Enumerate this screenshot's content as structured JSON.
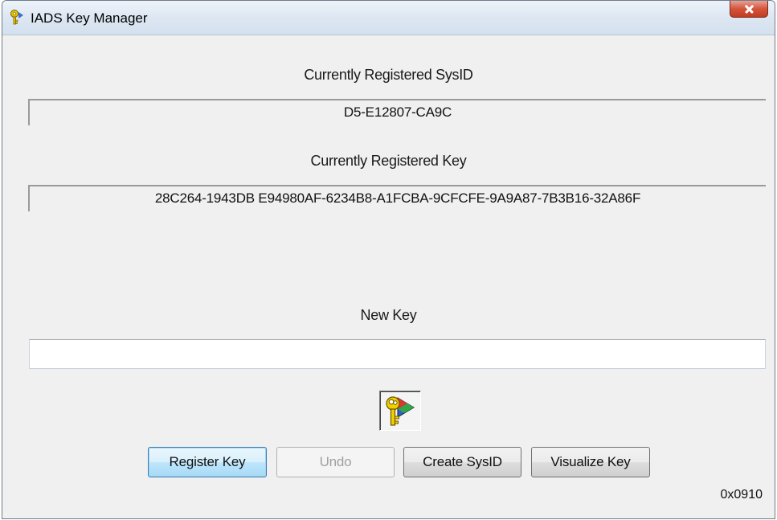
{
  "window": {
    "title": "IADS Key Manager",
    "app_icon": "key-icon",
    "close_icon": "close-icon"
  },
  "sysid": {
    "label": "Currently Registered SysID",
    "value": "D5-E12807-CA9C"
  },
  "registered_key": {
    "label": "Currently Registered Key",
    "value": "28C264-1943DB  E94980AF-6234B8-A1FCBA-9CFCFE-9A9A87-7B3B16-32A86F"
  },
  "new_key": {
    "label": "New Key",
    "value": ""
  },
  "key_visual_icon": "key-visual-icon",
  "buttons": {
    "register_key": "Register Key",
    "undo": "Undo",
    "create_sysid": "Create SysID",
    "visualize_key": "Visualize Key"
  },
  "version": "0x0910"
}
